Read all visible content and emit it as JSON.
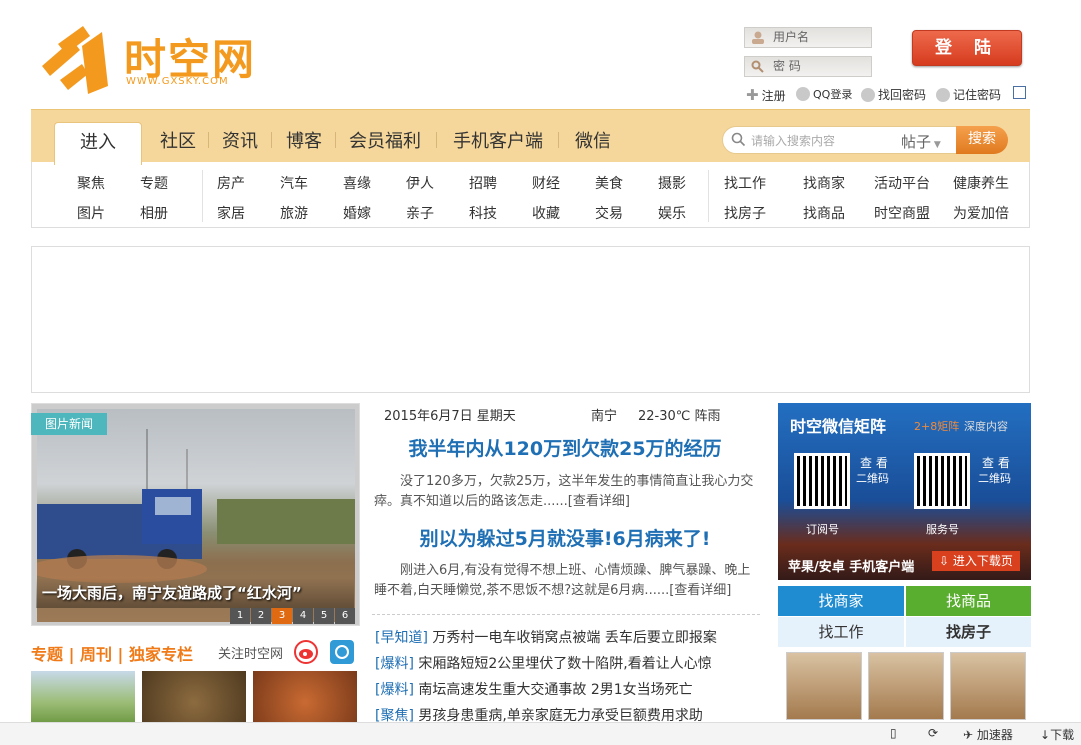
{
  "logo": {
    "text": "时空网",
    "url": "WWW.GXSKY.COM"
  },
  "login": {
    "username_placeholder": "用户名",
    "password_placeholder": "密  码",
    "login_btn": "登 陆",
    "register": "注册",
    "qq_login": "QQ登录",
    "find_pwd": "找回密码",
    "remember": "记住密码"
  },
  "nav": {
    "tabs": [
      "进入",
      "社区",
      "资讯",
      "博客",
      "会员福利",
      "手机客户端",
      "微信"
    ]
  },
  "search": {
    "placeholder": "请输入搜索内容",
    "scope": "帖子",
    "button": "搜索"
  },
  "subnav": {
    "g1r1": [
      "聚焦",
      "专题"
    ],
    "g1r2": [
      "图片",
      "相册"
    ],
    "g2r1": [
      "房产",
      "汽车",
      "喜缘",
      "伊人",
      "招聘",
      "财经",
      "美食",
      "摄影"
    ],
    "g2r2": [
      "家居",
      "旅游",
      "婚嫁",
      "亲子",
      "科技",
      "收藏",
      "交易",
      "娱乐"
    ],
    "g3r1": [
      "找工作",
      "找商家",
      "活动平台",
      "健康养生"
    ],
    "g3r2": [
      "找房子",
      "找商品",
      "时空商盟",
      "为爱加倍"
    ]
  },
  "photo": {
    "badge": "图片新闻",
    "caption": "一场大雨后，南宁友谊路成了“红水河”",
    "pages": [
      "1",
      "2",
      "3",
      "4",
      "5",
      "6"
    ]
  },
  "columns": {
    "title": "专题 | 周刊 | 独家专栏",
    "follow": "关注时空网"
  },
  "info": {
    "date": "2015年6月7日 星期天",
    "city": "南宁",
    "weather": "22-30℃ 阵雨"
  },
  "headlines": [
    {
      "title": "我半年内从120万到欠款25万的经历",
      "summary": "没了120多万，欠款25万，这半年发生的事情简直让我心力交瘁。真不知道以后的路该怎走......",
      "more": "[查看详细]"
    },
    {
      "title": "别以为躲过5月就没事!6月病来了!",
      "summary": "刚进入6月,有没有觉得不想上班、心情烦躁、脾气暴躁、晚上睡不着,白天睡懒觉,茶不思饭不想?这就是6月病......",
      "more": "[查看详细]"
    }
  ],
  "news": [
    {
      "tag": "[早知道]",
      "text": "万秀村一电车收销窝点被端 丢车后要立即报案"
    },
    {
      "tag": "[爆料]",
      "text": "宋厢路短短2公里埋伏了数十陷阱,看着让人心惊"
    },
    {
      "tag": "[爆料]",
      "text": "南坛高速发生重大交通事故 2男1女当场死亡"
    },
    {
      "tag": "[聚焦]",
      "text": "男孩身患重病,单亲家庭无力承受巨额费用求助"
    }
  ],
  "wechat": {
    "title": "时空微信矩阵",
    "tag": "2+8矩阵",
    "deep": "深度内容",
    "scan1": "查 看",
    "qr1": "二维码",
    "scan2": "查 看",
    "qr2": "二维码",
    "sub": "订阅号",
    "svc": "服务号",
    "app": "苹果/安卓  手机客户端",
    "download": "进入下载页"
  },
  "grid": {
    "a": "找商家",
    "b": "找商品",
    "c": "找工作",
    "d": "找房子"
  },
  "status": {
    "accel": "加速器",
    "download": "下载"
  },
  "colors": {
    "orange": "#f39a1e",
    "nav": "#f5d79b",
    "blue": "#1f6fb4",
    "teal": "#4db7bd",
    "green": "#59ad2f"
  }
}
